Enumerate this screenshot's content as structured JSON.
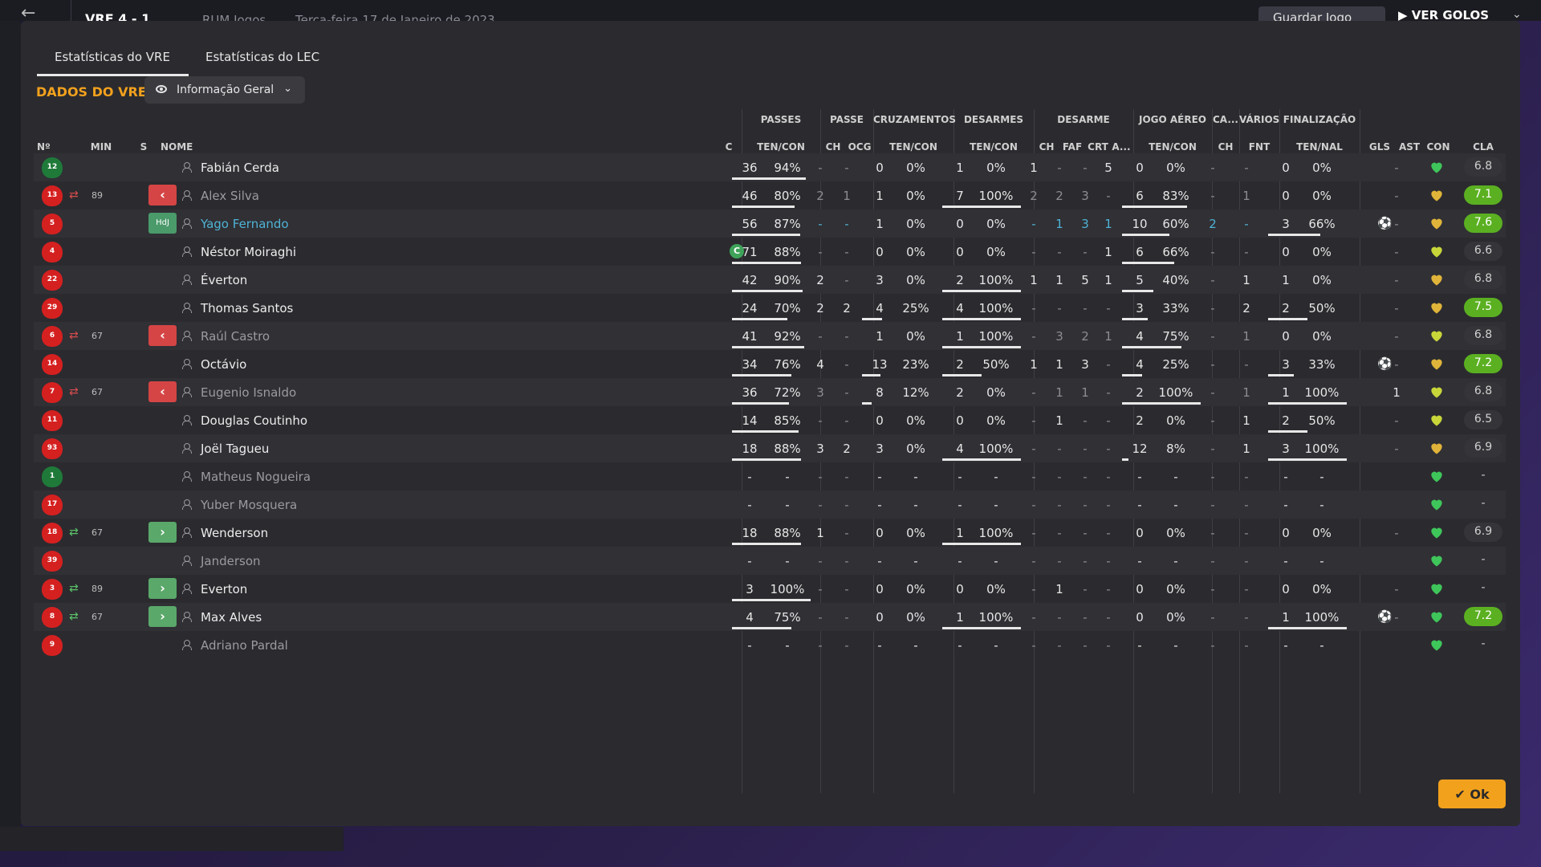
{
  "topbar": {
    "score": "VRE  4 - 1",
    "opponent": "RUM Jogos",
    "date": "Terça-feira 17 de Janeiro de 2023",
    "save_label": "Guardar Jogo",
    "play_label": "VER GOLOS"
  },
  "tabs": [
    "Estatísticas do VRE",
    "Estatísticas do LEC"
  ],
  "section_title": "DADOS DO VRE",
  "view_dropdown": "Informação Geral",
  "groups": {
    "passes": "PASSES",
    "passe": "PASSE",
    "cruzamentos": "CRUZAMENTOS",
    "desarmes": "DESARMES",
    "desarme": "DESARME",
    "jogo_aereo": "JOGO AÉREO",
    "ca": "CA...",
    "varios": "VÁRIOS",
    "finalizacao": "FINALIZAÇÃO"
  },
  "headers": {
    "num": "Nº",
    "min": "MIN",
    "s": "S",
    "nome": "NOME",
    "c": "C",
    "passes_tc": "TEN/CON",
    "ch": "CH",
    "ocg": "OCG",
    "cruz_tc": "TEN/CON",
    "des_tc": "TEN/CON",
    "d_ch": "CH",
    "faf": "FAF",
    "crt": "CRT",
    "a": "A...",
    "aer_tc": "TEN/CON",
    "ca_ch": "CH",
    "fnt": "FNT",
    "fin_tn": "TEN/NAL",
    "gls": "GLS",
    "ast": "AST",
    "con": "CON",
    "cla": "CLA"
  },
  "players": [
    {
      "num": "12",
      "gk": true,
      "min": "",
      "sub": "",
      "name": "Fabián Cerda",
      "style": "",
      "cap": false,
      "p1": "36",
      "p2": "94%",
      "pf": 0.94,
      "ch": "-",
      "ocg": "-",
      "cr1": "0",
      "cr2": "0%",
      "crf": 0,
      "d1": "1",
      "d2": "0%",
      "df": 0,
      "dch": "1",
      "faf": "-",
      "crt": "-",
      "a": "5",
      "j1": "0",
      "j2": "0%",
      "jf": 0,
      "cach": "-",
      "fnt": "-",
      "f1": "0",
      "f2": "0%",
      "ff": 0,
      "gls": "",
      "ast": "-",
      "heart": "green",
      "cla": "6.8",
      "hi": false,
      "dimstats": false
    },
    {
      "num": "13",
      "gk": false,
      "min": "89",
      "sub": "out",
      "name": "Alex Silva",
      "style": "dim",
      "cap": false,
      "p1": "46",
      "p2": "80%",
      "pf": 0.8,
      "ch": "2",
      "ocg": "1",
      "cr1": "1",
      "cr2": "0%",
      "crf": 0,
      "d1": "7",
      "d2": "100%",
      "df": 1,
      "dch": "2",
      "faf": "2",
      "crt": "3",
      "a": "-",
      "j1": "6",
      "j2": "83%",
      "jf": 0.83,
      "cach": "-",
      "fnt": "1",
      "f1": "0",
      "f2": "0%",
      "ff": 0,
      "gls": "",
      "ast": "-",
      "heart": "gold",
      "cla": "7.1",
      "hi": true,
      "dimstats": true
    },
    {
      "num": "5",
      "gk": false,
      "min": "",
      "sub": "hdj",
      "name": "Yago Fernando",
      "style": "blue",
      "cap": false,
      "p1": "56",
      "p2": "87%",
      "pf": 0.87,
      "ch": "-",
      "ocg": "-",
      "cr1": "1",
      "cr2": "0%",
      "crf": 0,
      "d1": "0",
      "d2": "0%",
      "df": 0,
      "dch": "-",
      "faf": "1",
      "crt": "3",
      "a": "1",
      "j1": "10",
      "j2": "60%",
      "jf": 0.6,
      "cach": "2",
      "fnt": "-",
      "f1": "3",
      "f2": "66%",
      "ff": 0.66,
      "gls": "goal",
      "ast": "-",
      "heart": "gold",
      "cla": "7.6",
      "hi": true,
      "dimstats": false,
      "bluestats": true
    },
    {
      "num": "4",
      "gk": false,
      "min": "",
      "sub": "",
      "name": "Néstor Moiraghi",
      "style": "",
      "cap": true,
      "p1": "71",
      "p2": "88%",
      "pf": 0.88,
      "ch": "-",
      "ocg": "-",
      "cr1": "0",
      "cr2": "0%",
      "crf": 0,
      "d1": "0",
      "d2": "0%",
      "df": 0,
      "dch": "-",
      "faf": "-",
      "crt": "-",
      "a": "1",
      "j1": "6",
      "j2": "66%",
      "jf": 0.66,
      "cach": "-",
      "fnt": "-",
      "f1": "0",
      "f2": "0%",
      "ff": 0,
      "gls": "",
      "ast": "-",
      "heart": "yellow",
      "cla": "6.6",
      "hi": false,
      "dimstats": false
    },
    {
      "num": "22",
      "gk": false,
      "min": "",
      "sub": "",
      "name": "Éverton",
      "style": "",
      "cap": false,
      "p1": "42",
      "p2": "90%",
      "pf": 0.9,
      "ch": "2",
      "ocg": "-",
      "cr1": "3",
      "cr2": "0%",
      "crf": 0,
      "d1": "2",
      "d2": "100%",
      "df": 1,
      "dch": "1",
      "faf": "1",
      "crt": "5",
      "a": "1",
      "j1": "5",
      "j2": "40%",
      "jf": 0.4,
      "cach": "-",
      "fnt": "1",
      "f1": "1",
      "f2": "0%",
      "ff": 0,
      "gls": "",
      "ast": "-",
      "heart": "gold",
      "cla": "6.8",
      "hi": false,
      "dimstats": false
    },
    {
      "num": "29",
      "gk": false,
      "min": "",
      "sub": "",
      "name": "Thomas Santos",
      "style": "",
      "cap": false,
      "p1": "24",
      "p2": "70%",
      "pf": 0.7,
      "ch": "2",
      "ocg": "2",
      "cr1": "4",
      "cr2": "25%",
      "crf": 0.25,
      "d1": "4",
      "d2": "100%",
      "df": 1,
      "dch": "-",
      "faf": "-",
      "crt": "-",
      "a": "-",
      "j1": "3",
      "j2": "33%",
      "jf": 0.33,
      "cach": "-",
      "fnt": "2",
      "f1": "2",
      "f2": "50%",
      "ff": 0.5,
      "gls": "",
      "ast": "-",
      "heart": "gold",
      "cla": "7.5",
      "hi": true,
      "dimstats": false
    },
    {
      "num": "6",
      "gk": false,
      "min": "67",
      "sub": "out",
      "name": "Raúl Castro",
      "style": "dim",
      "cap": false,
      "p1": "41",
      "p2": "92%",
      "pf": 0.92,
      "ch": "-",
      "ocg": "-",
      "cr1": "1",
      "cr2": "0%",
      "crf": 0,
      "d1": "1",
      "d2": "100%",
      "df": 1,
      "dch": "-",
      "faf": "3",
      "crt": "2",
      "a": "1",
      "j1": "4",
      "j2": "75%",
      "jf": 0.75,
      "cach": "-",
      "fnt": "1",
      "f1": "0",
      "f2": "0%",
      "ff": 0,
      "gls": "",
      "ast": "-",
      "heart": "yellow",
      "cla": "6.8",
      "hi": false,
      "dimstats": true
    },
    {
      "num": "14",
      "gk": false,
      "min": "",
      "sub": "",
      "name": "Octávio",
      "style": "",
      "cap": false,
      "p1": "34",
      "p2": "76%",
      "pf": 0.76,
      "ch": "4",
      "ocg": "-",
      "cr1": "13",
      "cr2": "23%",
      "crf": 0.23,
      "d1": "2",
      "d2": "50%",
      "df": 0.5,
      "dch": "1",
      "faf": "1",
      "crt": "3",
      "a": "-",
      "j1": "4",
      "j2": "25%",
      "jf": 0.25,
      "cach": "-",
      "fnt": "-",
      "f1": "3",
      "f2": "33%",
      "ff": 0.33,
      "gls": "goal",
      "ast": "-",
      "heart": "gold",
      "cla": "7.2",
      "hi": true,
      "dimstats": false
    },
    {
      "num": "7",
      "gk": false,
      "min": "67",
      "sub": "out",
      "name": "Eugenio Isnaldo",
      "style": "dim",
      "cap": false,
      "p1": "36",
      "p2": "72%",
      "pf": 0.72,
      "ch": "3",
      "ocg": "-",
      "cr1": "8",
      "cr2": "12%",
      "crf": 0.12,
      "d1": "2",
      "d2": "0%",
      "df": 0,
      "dch": "-",
      "faf": "1",
      "crt": "1",
      "a": "-",
      "j1": "2",
      "j2": "100%",
      "jf": 1,
      "cach": "-",
      "fnt": "1",
      "f1": "1",
      "f2": "100%",
      "ff": 1,
      "gls": "",
      "ast": "1",
      "heart": "yellow",
      "cla": "6.8",
      "hi": false,
      "dimstats": true
    },
    {
      "num": "11",
      "gk": false,
      "min": "",
      "sub": "",
      "name": "Douglas Coutinho",
      "style": "",
      "cap": false,
      "p1": "14",
      "p2": "85%",
      "pf": 0.85,
      "ch": "-",
      "ocg": "-",
      "cr1": "0",
      "cr2": "0%",
      "crf": 0,
      "d1": "0",
      "d2": "0%",
      "df": 0,
      "dch": "-",
      "faf": "1",
      "crt": "-",
      "a": "-",
      "j1": "2",
      "j2": "0%",
      "jf": 0,
      "cach": "-",
      "fnt": "1",
      "f1": "2",
      "f2": "50%",
      "ff": 0.5,
      "gls": "",
      "ast": "-",
      "heart": "yellow",
      "cla": "6.5",
      "hi": false,
      "dimstats": false
    },
    {
      "num": "93",
      "gk": false,
      "min": "",
      "sub": "",
      "name": "Joël Tagueu",
      "style": "",
      "cap": false,
      "p1": "18",
      "p2": "88%",
      "pf": 0.88,
      "ch": "3",
      "ocg": "2",
      "cr1": "3",
      "cr2": "0%",
      "crf": 0,
      "d1": "4",
      "d2": "100%",
      "df": 1,
      "dch": "-",
      "faf": "-",
      "crt": "-",
      "a": "-",
      "j1": "12",
      "j2": "8%",
      "jf": 0.08,
      "cach": "-",
      "fnt": "1",
      "f1": "3",
      "f2": "100%",
      "ff": 1,
      "gls": "",
      "ast": "-",
      "heart": "gold",
      "cla": "6.9",
      "hi": false,
      "dimstats": false
    },
    {
      "num": "1",
      "gk": true,
      "min": "",
      "sub": "",
      "name": "Matheus Nogueira",
      "style": "dim",
      "cap": false,
      "p1": "-",
      "p2": "-",
      "pf": -1,
      "ch": "-",
      "ocg": "-",
      "cr1": "-",
      "cr2": "-",
      "crf": -1,
      "d1": "-",
      "d2": "-",
      "df": -1,
      "dch": "-",
      "faf": "-",
      "crt": "-",
      "a": "-",
      "j1": "-",
      "j2": "-",
      "jf": -1,
      "cach": "-",
      "fnt": "-",
      "f1": "-",
      "f2": "-",
      "ff": -1,
      "gls": "",
      "ast": "",
      "heart": "green",
      "cla": "-",
      "hi": false,
      "dimstats": false
    },
    {
      "num": "17",
      "gk": false,
      "min": "",
      "sub": "",
      "name": "Yuber Mosquera",
      "style": "dim",
      "cap": false,
      "p1": "-",
      "p2": "-",
      "pf": -1,
      "ch": "-",
      "ocg": "-",
      "cr1": "-",
      "cr2": "-",
      "crf": -1,
      "d1": "-",
      "d2": "-",
      "df": -1,
      "dch": "-",
      "faf": "-",
      "crt": "-",
      "a": "-",
      "j1": "-",
      "j2": "-",
      "jf": -1,
      "cach": "-",
      "fnt": "-",
      "f1": "-",
      "f2": "-",
      "ff": -1,
      "gls": "",
      "ast": "",
      "heart": "green",
      "cla": "-",
      "hi": false,
      "dimstats": false
    },
    {
      "num": "18",
      "gk": false,
      "min": "67",
      "sub": "in",
      "name": "Wenderson",
      "style": "",
      "cap": false,
      "p1": "18",
      "p2": "88%",
      "pf": 0.88,
      "ch": "1",
      "ocg": "-",
      "cr1": "0",
      "cr2": "0%",
      "crf": 0,
      "d1": "1",
      "d2": "100%",
      "df": 1,
      "dch": "-",
      "faf": "-",
      "crt": "-",
      "a": "-",
      "j1": "0",
      "j2": "0%",
      "jf": 0,
      "cach": "-",
      "fnt": "-",
      "f1": "0",
      "f2": "0%",
      "ff": 0,
      "gls": "",
      "ast": "-",
      "heart": "green",
      "cla": "6.9",
      "hi": false,
      "dimstats": false
    },
    {
      "num": "39",
      "gk": false,
      "min": "",
      "sub": "",
      "name": "Janderson",
      "style": "dim",
      "cap": false,
      "p1": "-",
      "p2": "-",
      "pf": -1,
      "ch": "-",
      "ocg": "-",
      "cr1": "-",
      "cr2": "-",
      "crf": -1,
      "d1": "-",
      "d2": "-",
      "df": -1,
      "dch": "-",
      "faf": "-",
      "crt": "-",
      "a": "-",
      "j1": "-",
      "j2": "-",
      "jf": -1,
      "cach": "-",
      "fnt": "-",
      "f1": "-",
      "f2": "-",
      "ff": -1,
      "gls": "",
      "ast": "",
      "heart": "green",
      "cla": "-",
      "hi": false,
      "dimstats": false
    },
    {
      "num": "3",
      "gk": false,
      "min": "89",
      "sub": "in",
      "name": "Everton",
      "style": "",
      "cap": false,
      "p1": "3",
      "p2": "100%",
      "pf": 1,
      "ch": "-",
      "ocg": "-",
      "cr1": "0",
      "cr2": "0%",
      "crf": 0,
      "d1": "0",
      "d2": "0%",
      "df": 0,
      "dch": "-",
      "faf": "1",
      "crt": "-",
      "a": "-",
      "j1": "0",
      "j2": "0%",
      "jf": 0,
      "cach": "-",
      "fnt": "-",
      "f1": "0",
      "f2": "0%",
      "ff": 0,
      "gls": "",
      "ast": "-",
      "heart": "green",
      "cla": "-",
      "hi": false,
      "dimstats": false
    },
    {
      "num": "8",
      "gk": false,
      "min": "67",
      "sub": "in",
      "name": "Max Alves",
      "style": "",
      "cap": false,
      "p1": "4",
      "p2": "75%",
      "pf": 0.75,
      "ch": "-",
      "ocg": "-",
      "cr1": "0",
      "cr2": "0%",
      "crf": 0,
      "d1": "1",
      "d2": "100%",
      "df": 1,
      "dch": "-",
      "faf": "-",
      "crt": "-",
      "a": "-",
      "j1": "0",
      "j2": "0%",
      "jf": 0,
      "cach": "-",
      "fnt": "-",
      "f1": "1",
      "f2": "100%",
      "ff": 1,
      "gls": "goal",
      "ast": "-",
      "heart": "green",
      "cla": "7.2",
      "hi": true,
      "dimstats": false
    },
    {
      "num": "9",
      "gk": false,
      "min": "",
      "sub": "",
      "name": "Adriano Pardal",
      "style": "dim",
      "cap": false,
      "p1": "-",
      "p2": "-",
      "pf": -1,
      "ch": "-",
      "ocg": "-",
      "cr1": "-",
      "cr2": "-",
      "crf": -1,
      "d1": "-",
      "d2": "-",
      "df": -1,
      "dch": "-",
      "faf": "-",
      "crt": "-",
      "a": "-",
      "j1": "-",
      "j2": "-",
      "jf": -1,
      "cach": "-",
      "fnt": "-",
      "f1": "-",
      "f2": "-",
      "ff": -1,
      "gls": "",
      "ast": "",
      "heart": "green",
      "cla": "-",
      "hi": false,
      "dimstats": false
    }
  ],
  "ok_label": "Ok",
  "colors": {
    "accent": "#f2a11d",
    "rating_high": "#5bb021",
    "kit_red": "#d52020",
    "kit_gk": "#1f7a3a"
  }
}
